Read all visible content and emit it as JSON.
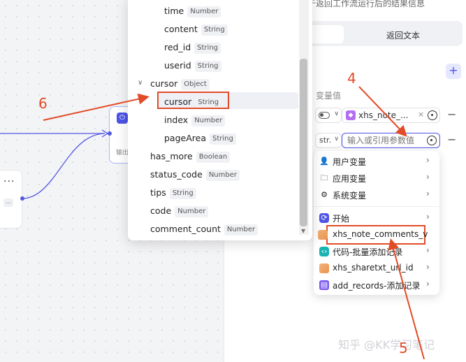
{
  "config_panel": {
    "description": "于返回工作流运行后的结果信息",
    "tab_right": "返回文本",
    "add_button": "+",
    "variable_value_header": "变量值",
    "row1": {
      "ref_name": "xhs_note_...",
      "remove": "−"
    },
    "row2": {
      "type_label": "str.",
      "input_placeholder": "输入或引用参数值",
      "remove": "−"
    }
  },
  "ref_dropdown": {
    "items": [
      {
        "label": "用户变量",
        "icon": "user-icon"
      },
      {
        "label": "应用变量",
        "icon": "folder-icon"
      },
      {
        "label": "系统变量",
        "icon": "gear-icon"
      },
      {
        "label": "开始",
        "icon": "start-node-icon"
      },
      {
        "label": "xhs_note_comments_v",
        "icon": "plugin-image-icon"
      },
      {
        "label": "代码-批量添加记录",
        "icon": "code-icon"
      },
      {
        "label": "xhs_sharetxt_url_id",
        "icon": "plugin-image-icon"
      },
      {
        "label": "add_records-添加记录",
        "icon": "database-icon"
      }
    ]
  },
  "variable_tree": {
    "items": [
      {
        "name": "time",
        "type": "Number"
      },
      {
        "name": "content",
        "type": "String"
      },
      {
        "name": "red_id",
        "type": "String"
      },
      {
        "name": "userid",
        "type": "String"
      },
      {
        "name": "cursor",
        "type": "Object"
      },
      {
        "name": "cursor",
        "type": "String"
      },
      {
        "name": "index",
        "type": "Number"
      },
      {
        "name": "pageArea",
        "type": "String"
      },
      {
        "name": "has_more",
        "type": "Boolean"
      },
      {
        "name": "status_code",
        "type": "Number"
      },
      {
        "name": "tips",
        "type": "String"
      },
      {
        "name": "code",
        "type": "Number"
      },
      {
        "name": "comment_count",
        "type": "Number"
      }
    ]
  },
  "canvas": {
    "left_node_menu": "...",
    "left_node_chip": "...",
    "target_node_output_label": "输出"
  },
  "annotations": {
    "step_4": "4",
    "step_5": "5",
    "step_6": "6",
    "color": "#e24b27"
  },
  "watermark": "知乎 @KK学习笔记"
}
